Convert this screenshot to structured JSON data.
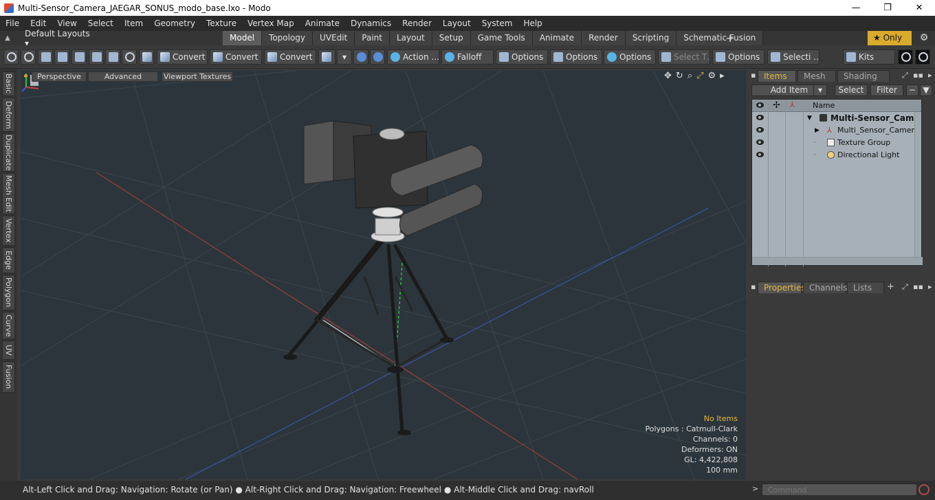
{
  "window": {
    "title": "Multi-Sensor_Camera_JAEGAR_SONUS_modo_base.lxo - Modo",
    "minimize": "—",
    "maximize": "❐",
    "close": "✕"
  },
  "menu": [
    "File",
    "Edit",
    "View",
    "Select",
    "Item",
    "Geometry",
    "Texture",
    "Vertex Map",
    "Animate",
    "Dynamics",
    "Render",
    "Layout",
    "System",
    "Help"
  ],
  "layouts": {
    "selector": "Default Layouts ▾",
    "tabs": [
      "Model",
      "Topology",
      "UVEdit",
      "Paint",
      "Layout",
      "Setup",
      "Game Tools",
      "Animate",
      "Render",
      "Scripting",
      "Schematic Fusion"
    ],
    "active_tab": "Model",
    "only_label": "★  Only"
  },
  "toolbar": {
    "convert1": "Convert",
    "convert2": "Convert",
    "convert3": "Convert",
    "action": "Action  …",
    "falloff": "Falloff",
    "options1": "Options",
    "options2": "Options",
    "options3": "Options",
    "options4": "Options",
    "select_t": "Select T…",
    "selecti": "Selecti …",
    "kits": "Kits"
  },
  "left_tabs": [
    "Basic",
    "Deform",
    "Duplicate",
    "Mesh Edit",
    "Vertex",
    "Edge",
    "Polygon",
    "Curve",
    "UV",
    "Fusion"
  ],
  "viewport": {
    "perspective": "Perspective",
    "advanced": "Advanced",
    "viewport_textures": "Viewport Textures",
    "info": {
      "no_items": "No Items",
      "polygons": "Polygons : Catmull-Clark",
      "channels": "Channels: 0",
      "deformers": "Deformers: ON",
      "gl": "GL: 4,422,808",
      "scale": "100 mm"
    }
  },
  "status": "Alt-Left Click and Drag: Navigation: Rotate (or Pan) ● Alt-Right Click and Drag: Navigation: Freewheel ● Alt-Middle Click and Drag: navRoll",
  "items_panel": {
    "tabs": [
      "Items",
      "Mesh …",
      "Shading"
    ],
    "add_item": "Add Item",
    "select": "Select",
    "filter": "Filter",
    "col_name": "Name",
    "rows": [
      {
        "name": "Multi-Sensor_Camer …",
        "bold": true
      },
      {
        "name": "Multi_Sensor_Camera …"
      },
      {
        "name": "Texture Group"
      },
      {
        "name": "Directional Light"
      }
    ]
  },
  "properties_panel": {
    "tabs": [
      "Properties",
      "Channels",
      "Lists"
    ],
    "plus": "+"
  },
  "command": {
    "placeholder": "Command"
  },
  "colors": {
    "accent": "#e8b83a",
    "viewport_bg": "#2c353b",
    "grid": "#3f4a51"
  }
}
